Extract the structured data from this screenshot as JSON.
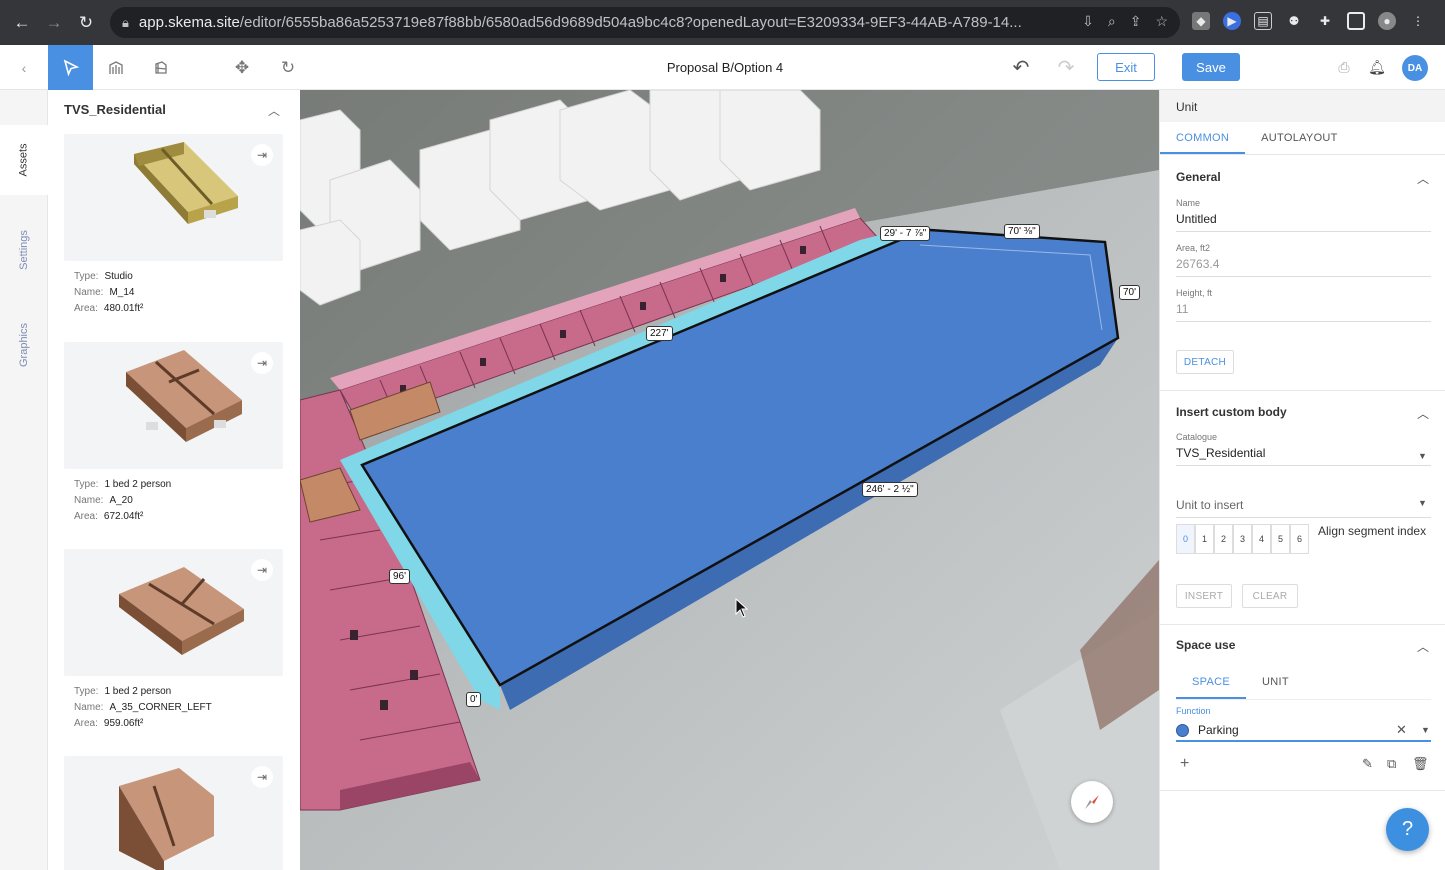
{
  "browser": {
    "url_host": "app.skema.site",
    "url_path": "/editor/6555ba86a5253719e87f88bb/6580ad56d9689d504a9bc4c8?openedLayout=E3209334-9EF3-44AB-A789-14..."
  },
  "toolbar": {
    "title": "Proposal B/Option 4",
    "exit_label": "Exit",
    "save_label": "Save",
    "avatar_initials": "DA"
  },
  "rail": {
    "tabs": [
      "Assets",
      "Settings",
      "Graphics"
    ]
  },
  "assets": {
    "catalogue_title": "TVS_Residential",
    "labels": {
      "type": "Type:",
      "name": "Name:",
      "area": "Area:"
    },
    "items": [
      {
        "type": "Studio",
        "name": "M_14",
        "area": "480.01ft²",
        "color": "#b8a24a"
      },
      {
        "type": "1 bed 2 person",
        "name": "A_20",
        "area": "672.04ft²",
        "color": "#9b6b4e"
      },
      {
        "type": "1 bed 2 person",
        "name": "A_35_CORNER_LEFT",
        "area": "959.06ft²",
        "color": "#9b6b4e"
      },
      {
        "type": "",
        "name": "",
        "area": "",
        "color": "#9b6b4e"
      }
    ]
  },
  "viewport": {
    "dimensions": [
      "29' - 7 ⅞\"",
      "70' ⅜\"",
      "70'",
      "227'",
      "246' - 2 ½\"",
      "96'",
      "0'"
    ],
    "colors": {
      "site": "#4a7fce",
      "outline": "#111111",
      "setback": "#7fd7e8",
      "residential": "#c86b8a"
    }
  },
  "props": {
    "header": "Unit",
    "tabs": [
      "COMMON",
      "AUTOLAYOUT"
    ],
    "general": {
      "title": "General",
      "name_label": "Name",
      "name_value": "Untitled",
      "area_label": "Area, ft2",
      "area_value": "26763.4",
      "height_label": "Height, ft",
      "height_value": "11",
      "detach_label": "DETACH"
    },
    "insert": {
      "title": "Insert custom body",
      "catalogue_label": "Catalogue",
      "catalogue_value": "TVS_Residential",
      "unit_placeholder": "Unit to insert",
      "segments": [
        "0",
        "1",
        "2",
        "3",
        "4",
        "5",
        "6"
      ],
      "align_label": "Align segment index",
      "insert_label": "INSERT",
      "clear_label": "CLEAR"
    },
    "space_use": {
      "title": "Space use",
      "tabs": [
        "SPACE",
        "UNIT"
      ],
      "function_label": "Function",
      "function_value": "Parking",
      "function_color": "#4a7fce"
    }
  },
  "help_label": "?"
}
